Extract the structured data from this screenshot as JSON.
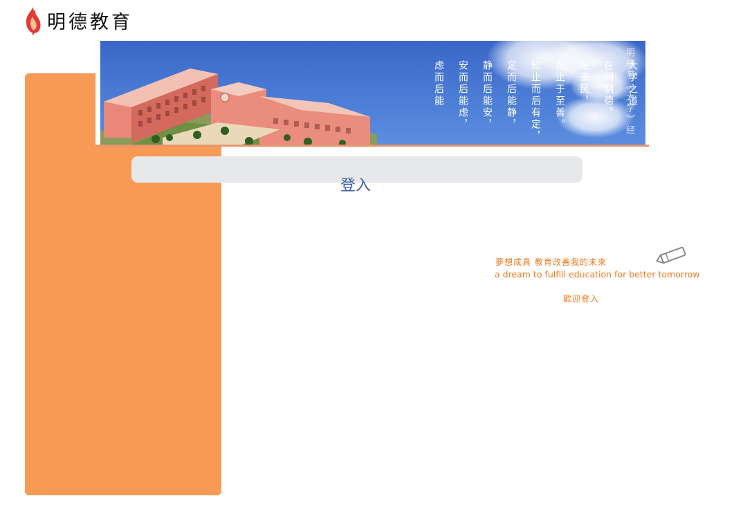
{
  "header": {
    "logo_text": "明德教育",
    "logo_icon": "flame-icon"
  },
  "banner": {
    "poem_columns": [
      "大学之道",
      "在明明德，",
      "在亲民，",
      "在止于至善。",
      "知止而后有定，",
      "定而后能静，",
      "静而后能安，",
      "安而后能虑，",
      "虑而后能"
    ],
    "side_text": "明德与《大学》经"
  },
  "login": {
    "title": "登入"
  },
  "slogan": {
    "chinese": "夢想成真 教育改善我的未來",
    "english": "a dream to fulfill education for better tomorrow",
    "welcome": "歡迎登入",
    "icon": "pencil-icon"
  },
  "colors": {
    "sidebar": "#f79a56",
    "banner_sky": "#4c7dd6",
    "login_bar": "#e7e8ea",
    "login_title": "#3f5fa8",
    "slogan": "#f07a1e"
  }
}
